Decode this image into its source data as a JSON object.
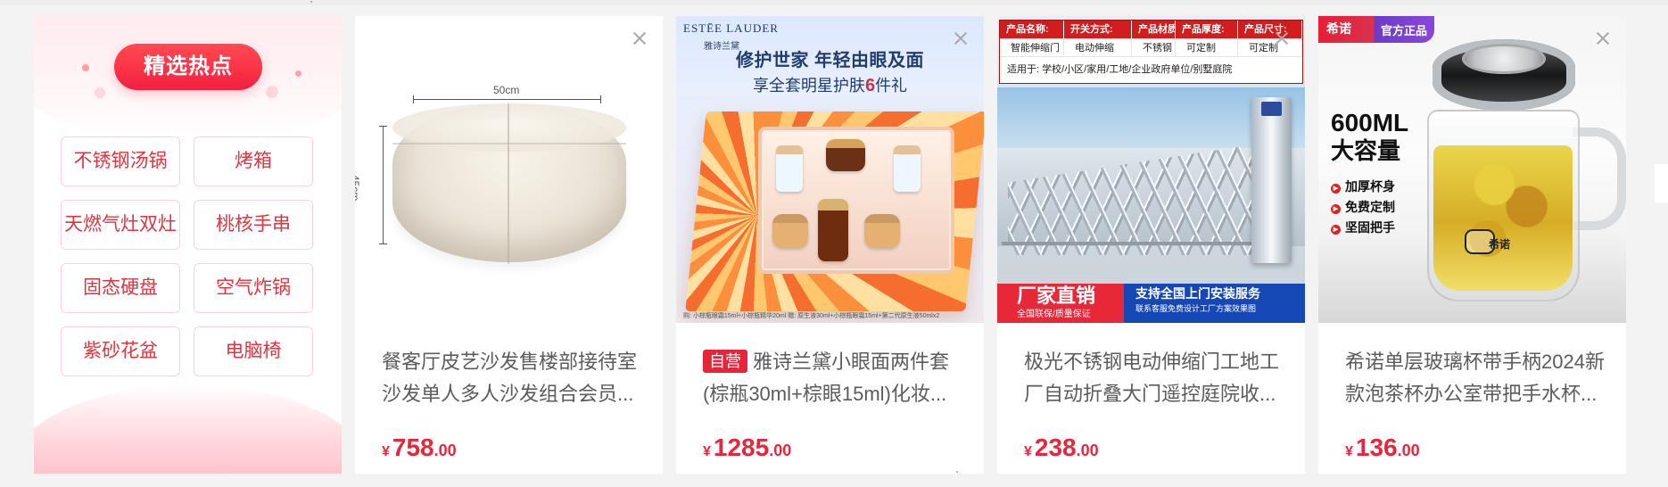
{
  "hot_panel": {
    "title": "精选热点",
    "tags": [
      "不锈钢汤锅",
      "烤箱",
      "天燃气灶双灶",
      "桃核手串",
      "固态硬盘",
      "空气炸锅",
      "紫砂花盆",
      "电脑椅"
    ]
  },
  "products": [
    {
      "title_lines": [
        "餐客厅皮艺沙发售楼部接待室",
        "沙发单人多人沙发组合会员..."
      ],
      "price": {
        "currency": "¥",
        "integer": "758",
        "decimal": ".00"
      },
      "image_text": {
        "width_label": "50cm",
        "height_label": "45cm"
      }
    },
    {
      "badge": "自营",
      "title_lines": [
        "雅诗兰黛小眼面两件套",
        "(棕瓶30ml+棕眼15ml)化妆..."
      ],
      "price": {
        "currency": "¥",
        "integer": "1285",
        "decimal": ".00"
      },
      "image_text": {
        "brand": "ESTĒE LAUDER",
        "brand_cn": "雅诗兰黛",
        "headline": "修护世家 年轻由眼及面",
        "subhead_prefix": "享全套明星护肤",
        "subhead_number": "6",
        "subhead_suffix": "件礼",
        "fine_print": "购: 小棕瓶眼霜15ml+小棕瓶精华20ml 赠: 原生液30ml+小棕瓶眼霜15ml+第二代原生液50mlx2"
      }
    },
    {
      "title_lines": [
        "极光不锈钢电动伸缩门工地工",
        "厂自动折叠大门遥控庭院收..."
      ],
      "price": {
        "currency": "¥",
        "integer": "238",
        "decimal": ".00"
      },
      "image_text": {
        "table_headers": [
          "产品名称:",
          "开关方式:",
          "产品材质:",
          "产品厚度:",
          "产品尺寸:"
        ],
        "table_values": [
          "智能伸缩门",
          "电动伸缩",
          "不锈钢",
          "可定制",
          "可定制"
        ],
        "application": "适用于: 学校/小区/家用/工地/企业政府单位/别墅庭院",
        "red_banner_title": "厂家直销",
        "red_banner_sub": "全国联保/质量保证",
        "blue_banner_title": "支持全国上门安装服务",
        "blue_banner_sub": "联系客服免费设计工厂方案效果图"
      }
    },
    {
      "title_lines": [
        "希诺单层玻璃杯带手柄2024新",
        "款泡茶杯办公室带把手水杯..."
      ],
      "price": {
        "currency": "¥",
        "integer": "136",
        "decimal": ".00"
      },
      "image_text": {
        "brand": "希诺",
        "official": "官方正品",
        "capacity": "600ML",
        "capacity_cn": "大容量",
        "features": [
          "加厚杯身",
          "免费定制",
          "坚固把手"
        ],
        "mascot": "希诺"
      }
    }
  ],
  "colors": {
    "accent_red": "#e7263d",
    "tag_red": "#e2333f",
    "muted_text": "#5b5b5b",
    "page_background": "#f3f3f3"
  },
  "icons": {
    "close": "close-icon"
  }
}
